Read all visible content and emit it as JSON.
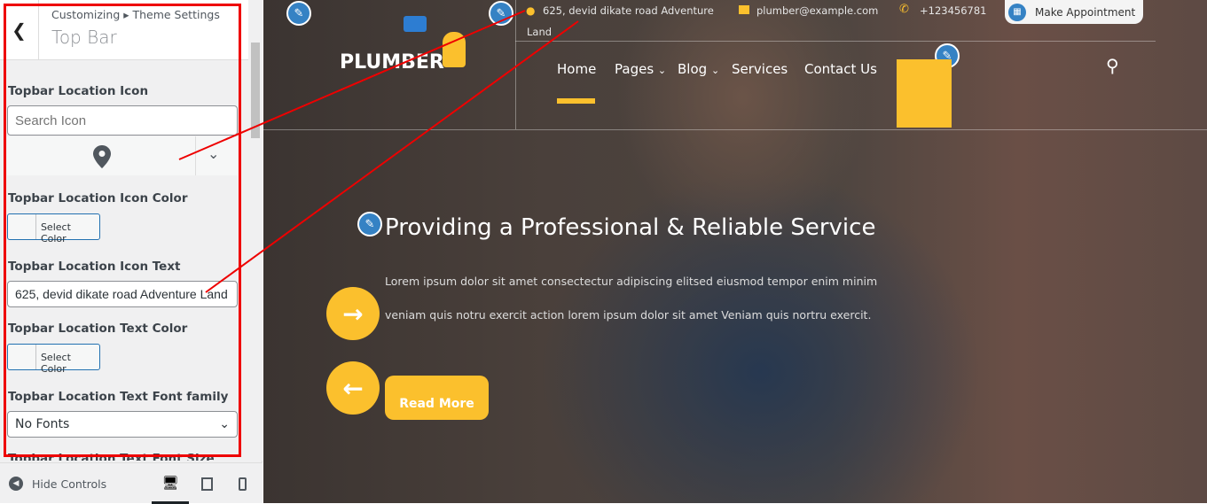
{
  "panel": {
    "breadcrumb": "Customizing ▸ Theme Settings",
    "title": "Top Bar",
    "fields": [
      {
        "label": "Topbar Location Icon",
        "search_placeholder": "Search Icon",
        "selected_icon": "map-marker-icon"
      },
      {
        "label": "Topbar Location Icon Color",
        "button": "Select Color"
      },
      {
        "label": "Topbar Location Icon Text",
        "value": "625, devid dikate road Adventure Land"
      },
      {
        "label": "Topbar Location Text Color",
        "button": "Select Color"
      },
      {
        "label": "Topbar Location Text Font family",
        "value": "No Fonts"
      },
      {
        "label": "Topbar Location Text Font Size"
      }
    ],
    "hide_controls": "Hide Controls",
    "devices": [
      "desktop",
      "tablet",
      "mobile"
    ]
  },
  "site": {
    "logo": "PLUMBER",
    "topbar": {
      "address": "625, devid dikate road Adventure",
      "address2": "Land",
      "email": "plumber@example.com",
      "phone": "+123456781",
      "appointment": "Make Appointment"
    },
    "nav": [
      "Home",
      "Pages",
      "Blog",
      "Services",
      "Contact Us"
    ],
    "hero": {
      "title": "Providing a Professional & Reliable Service",
      "text1": "Lorem ipsum dolor sit amet consectectur adipiscing elitsed eiusmod tempor enim minim",
      "text2": "veniam quis notru exercit action lorem ipsum dolor sit amet Veniam quis nortru exercit.",
      "button": "Read More"
    },
    "colors": {
      "accent": "#fbc02d",
      "edit": "#3582c4",
      "annotation": "#ee0000"
    }
  }
}
